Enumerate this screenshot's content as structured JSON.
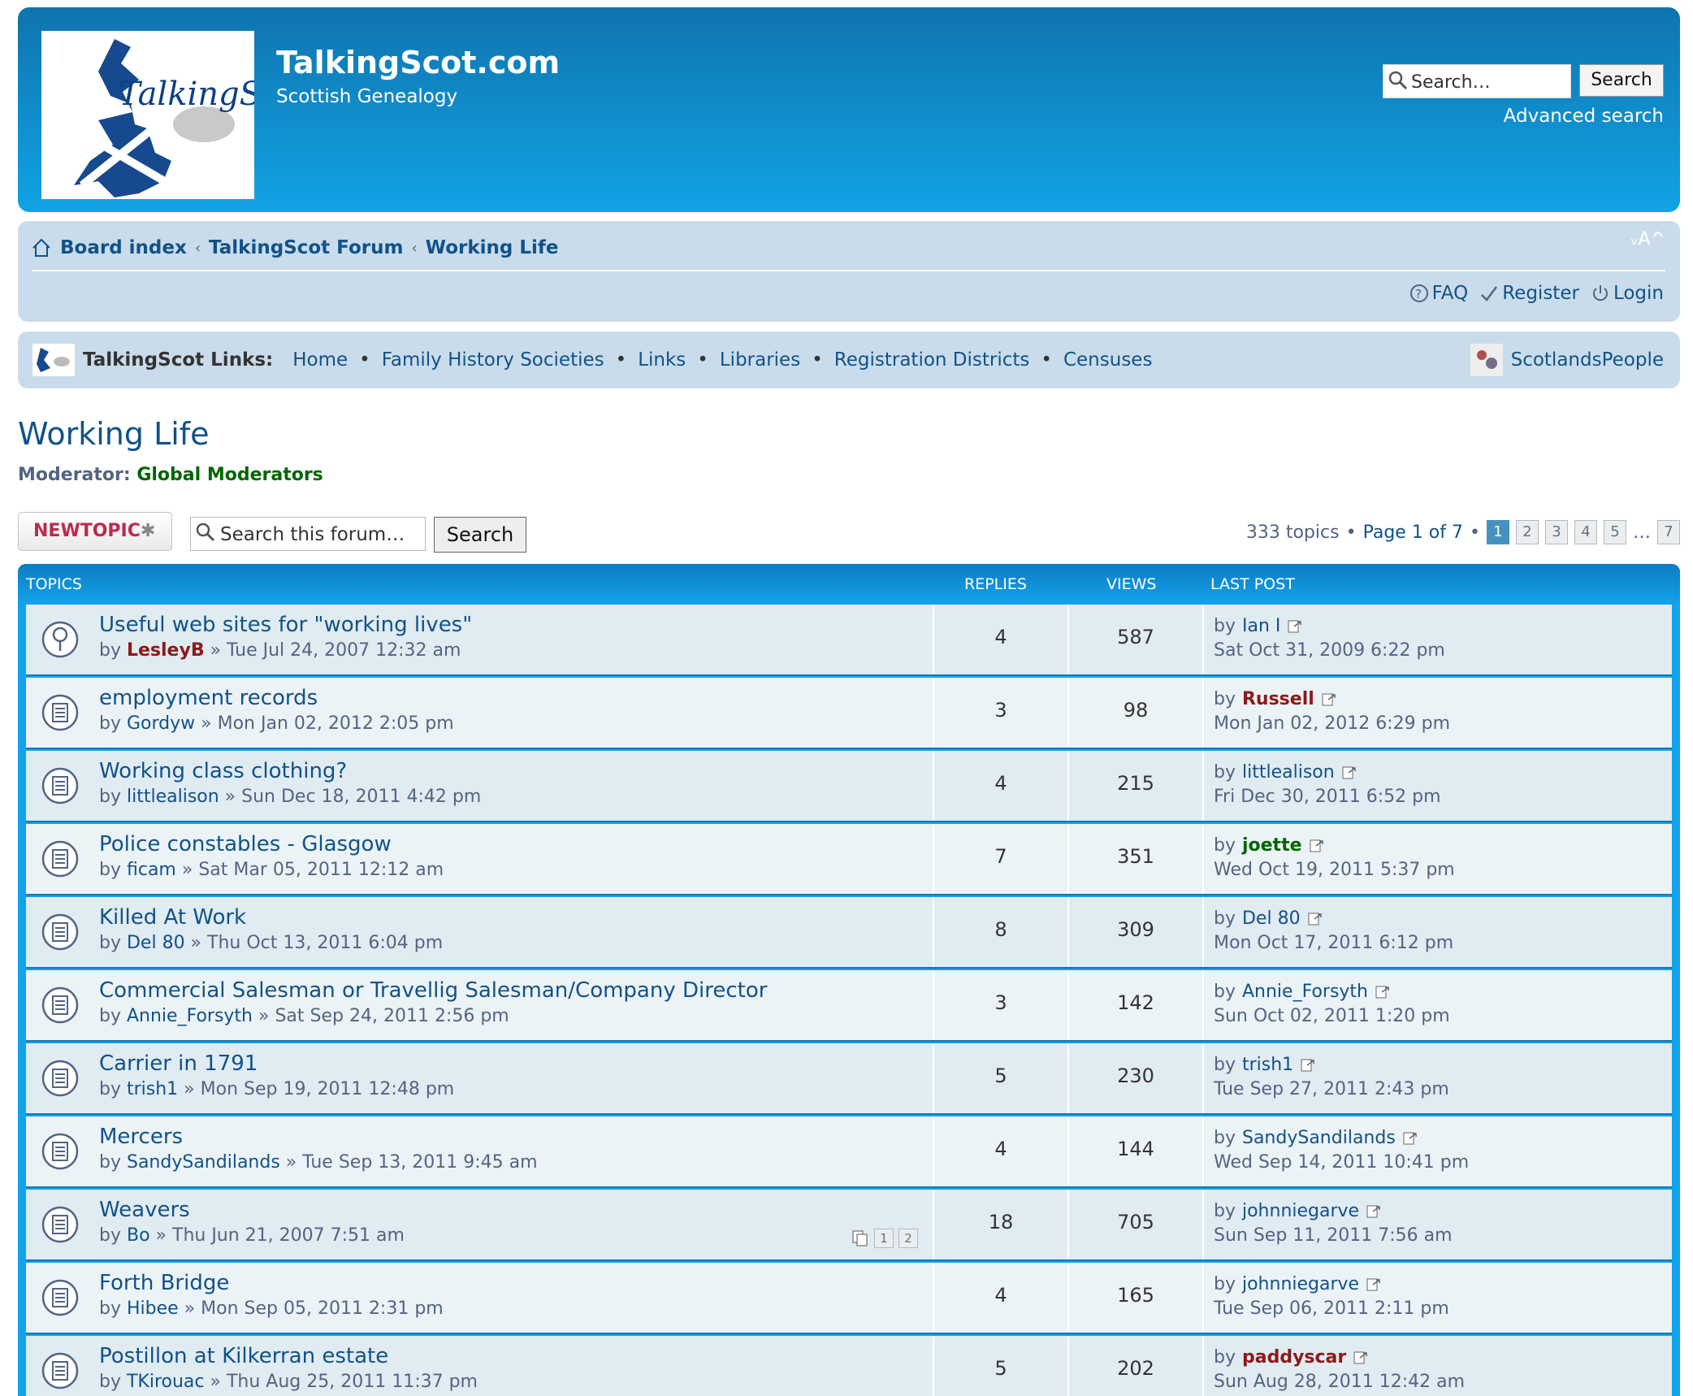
{
  "header": {
    "logo_text": "TalkingScot",
    "site_title": "TalkingScot.com",
    "site_desc": "Scottish Genealogy",
    "search_placeholder": "Search…",
    "search_button": "Search",
    "advanced_search": "Advanced search"
  },
  "breadcrumbs": [
    "Board index",
    "TalkingScot Forum",
    "Working Life"
  ],
  "font_size_control": "ᵥA^",
  "userlinks": {
    "faq": "FAQ",
    "register": "Register",
    "login": "Login"
  },
  "links_bar": {
    "title": "TalkingScot Links:",
    "items": [
      "Home",
      "Family History Societies",
      "Links",
      "Libraries",
      "Registration Districts",
      "Censuses"
    ],
    "right": "ScotlandsPeople"
  },
  "forum": {
    "title": "Working Life",
    "moderator_label": "Moderator:",
    "moderator": "Global Moderators"
  },
  "actions": {
    "new_topic": "NEWTOPIC",
    "search_placeholder": "Search this forum…",
    "search_button": "Search",
    "topics_count": "333 topics",
    "page_info": "Page 1 of 7",
    "pages": [
      "1",
      "2",
      "3",
      "4",
      "5"
    ],
    "ellipsis": "…",
    "last_page": "7"
  },
  "table": {
    "headers": {
      "topics": "TOPICS",
      "replies": "REPLIES",
      "views": "VIEWS",
      "last_post": "LAST POST"
    },
    "rows": [
      {
        "icon": "sticky-topic-icon",
        "title": "Useful web sites for \"working lives\"",
        "author": "LesleyB",
        "author_style": "red",
        "date": "Tue Jul 24, 2007 12:32 am",
        "replies": "4",
        "views": "587",
        "last_by": "Ian I",
        "last_by_style": "normal",
        "last_date": "Sat Oct 31, 2009 6:22 pm"
      },
      {
        "icon": "topic-icon",
        "title": "employment records",
        "author": "Gordyw",
        "author_style": "normal",
        "date": "Mon Jan 02, 2012 2:05 pm",
        "replies": "3",
        "views": "98",
        "last_by": "Russell",
        "last_by_style": "red",
        "last_date": "Mon Jan 02, 2012 6:29 pm"
      },
      {
        "icon": "topic-icon",
        "title": "Working class clothing?",
        "author": "littlealison",
        "author_style": "normal",
        "date": "Sun Dec 18, 2011 4:42 pm",
        "replies": "4",
        "views": "215",
        "last_by": "littlealison",
        "last_by_style": "normal",
        "last_date": "Fri Dec 30, 2011 6:52 pm"
      },
      {
        "icon": "topic-icon",
        "title": "Police constables - Glasgow",
        "author": "ficam",
        "author_style": "normal",
        "date": "Sat Mar 05, 2011 12:12 am",
        "replies": "7",
        "views": "351",
        "last_by": "joette",
        "last_by_style": "green",
        "last_date": "Wed Oct 19, 2011 5:37 pm"
      },
      {
        "icon": "topic-icon",
        "title": "Killed At Work",
        "author": "Del 80",
        "author_style": "normal",
        "date": "Thu Oct 13, 2011 6:04 pm",
        "replies": "8",
        "views": "309",
        "last_by": "Del 80",
        "last_by_style": "normal",
        "last_date": "Mon Oct 17, 2011 6:12 pm"
      },
      {
        "icon": "topic-icon",
        "title": "Commercial Salesman or Travellig Salesman/Company Director",
        "author": "Annie_Forsyth",
        "author_style": "normal",
        "date": "Sat Sep 24, 2011 2:56 pm",
        "replies": "3",
        "views": "142",
        "last_by": "Annie_Forsyth",
        "last_by_style": "normal",
        "last_date": "Sun Oct 02, 2011 1:20 pm"
      },
      {
        "icon": "topic-icon",
        "title": "Carrier in 1791",
        "author": "trish1",
        "author_style": "normal",
        "date": "Mon Sep 19, 2011 12:48 pm",
        "replies": "5",
        "views": "230",
        "last_by": "trish1",
        "last_by_style": "normal",
        "last_date": "Tue Sep 27, 2011 2:43 pm"
      },
      {
        "icon": "topic-icon",
        "title": "Mercers",
        "author": "SandySandilands",
        "author_style": "normal",
        "date": "Tue Sep 13, 2011 9:45 am",
        "replies": "4",
        "views": "144",
        "last_by": "SandySandilands",
        "last_by_style": "normal",
        "last_date": "Wed Sep 14, 2011 10:41 pm"
      },
      {
        "icon": "topic-icon",
        "title": "Weavers",
        "author": "Bo",
        "author_style": "normal",
        "date": "Thu Jun 21, 2007 7:51 am",
        "replies": "18",
        "views": "705",
        "last_by": "johnniegarve",
        "last_by_style": "normal",
        "last_date": "Sun Sep 11, 2011 7:56 am",
        "mini_pages": [
          "1",
          "2"
        ]
      },
      {
        "icon": "topic-icon",
        "title": "Forth Bridge",
        "author": "Hibee",
        "author_style": "normal",
        "date": "Mon Sep 05, 2011 2:31 pm",
        "replies": "4",
        "views": "165",
        "last_by": "johnniegarve",
        "last_by_style": "normal",
        "last_date": "Tue Sep 06, 2011 2:11 pm"
      },
      {
        "icon": "topic-icon",
        "title": "Postillon at Kilkerran estate",
        "author": "TKirouac",
        "author_style": "normal",
        "date": "Thu Aug 25, 2011 11:37 pm",
        "replies": "5",
        "views": "202",
        "last_by": "paddyscar",
        "last_by_style": "red",
        "last_date": "Sun Aug 28, 2011 12:42 am"
      }
    ]
  }
}
